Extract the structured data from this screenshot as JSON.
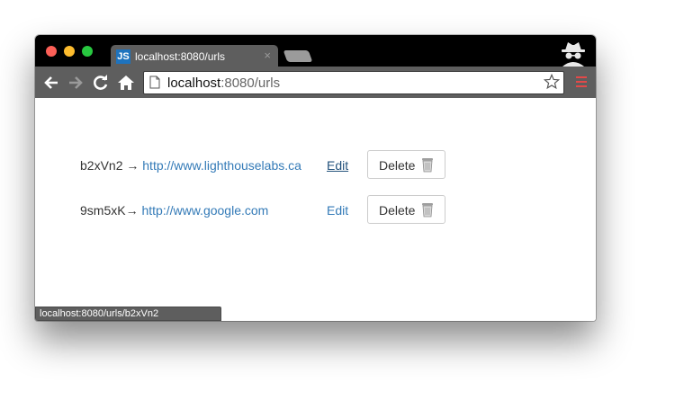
{
  "browser": {
    "tab": {
      "favicon_text": "JS",
      "title": "localhost:8080/urls",
      "close_glyph": "×"
    },
    "address_bar": {
      "host": "localhost",
      "rest": ":8080/urls"
    },
    "status_bar": {
      "text": "localhost:8080/urls/b2xVn2"
    },
    "icons": [
      "back-icon",
      "forward-icon",
      "reload-icon",
      "home-icon",
      "page-icon",
      "bookmark-star-icon",
      "menu-icon",
      "incognito-icon"
    ]
  },
  "urls": [
    {
      "short": "b2xVn2",
      "arrow": "→",
      "long": "http://www.lighthouselabs.ca",
      "edit_label": "Edit",
      "delete_label": "Delete"
    },
    {
      "short": "9sm5xK",
      "arrow": "→",
      "long": "http://www.google.com",
      "edit_label": "Edit",
      "delete_label": "Delete"
    }
  ],
  "colors": {
    "link": "#337ab7",
    "link_hover": "#23527c",
    "chrome": "#5e5e5e"
  }
}
